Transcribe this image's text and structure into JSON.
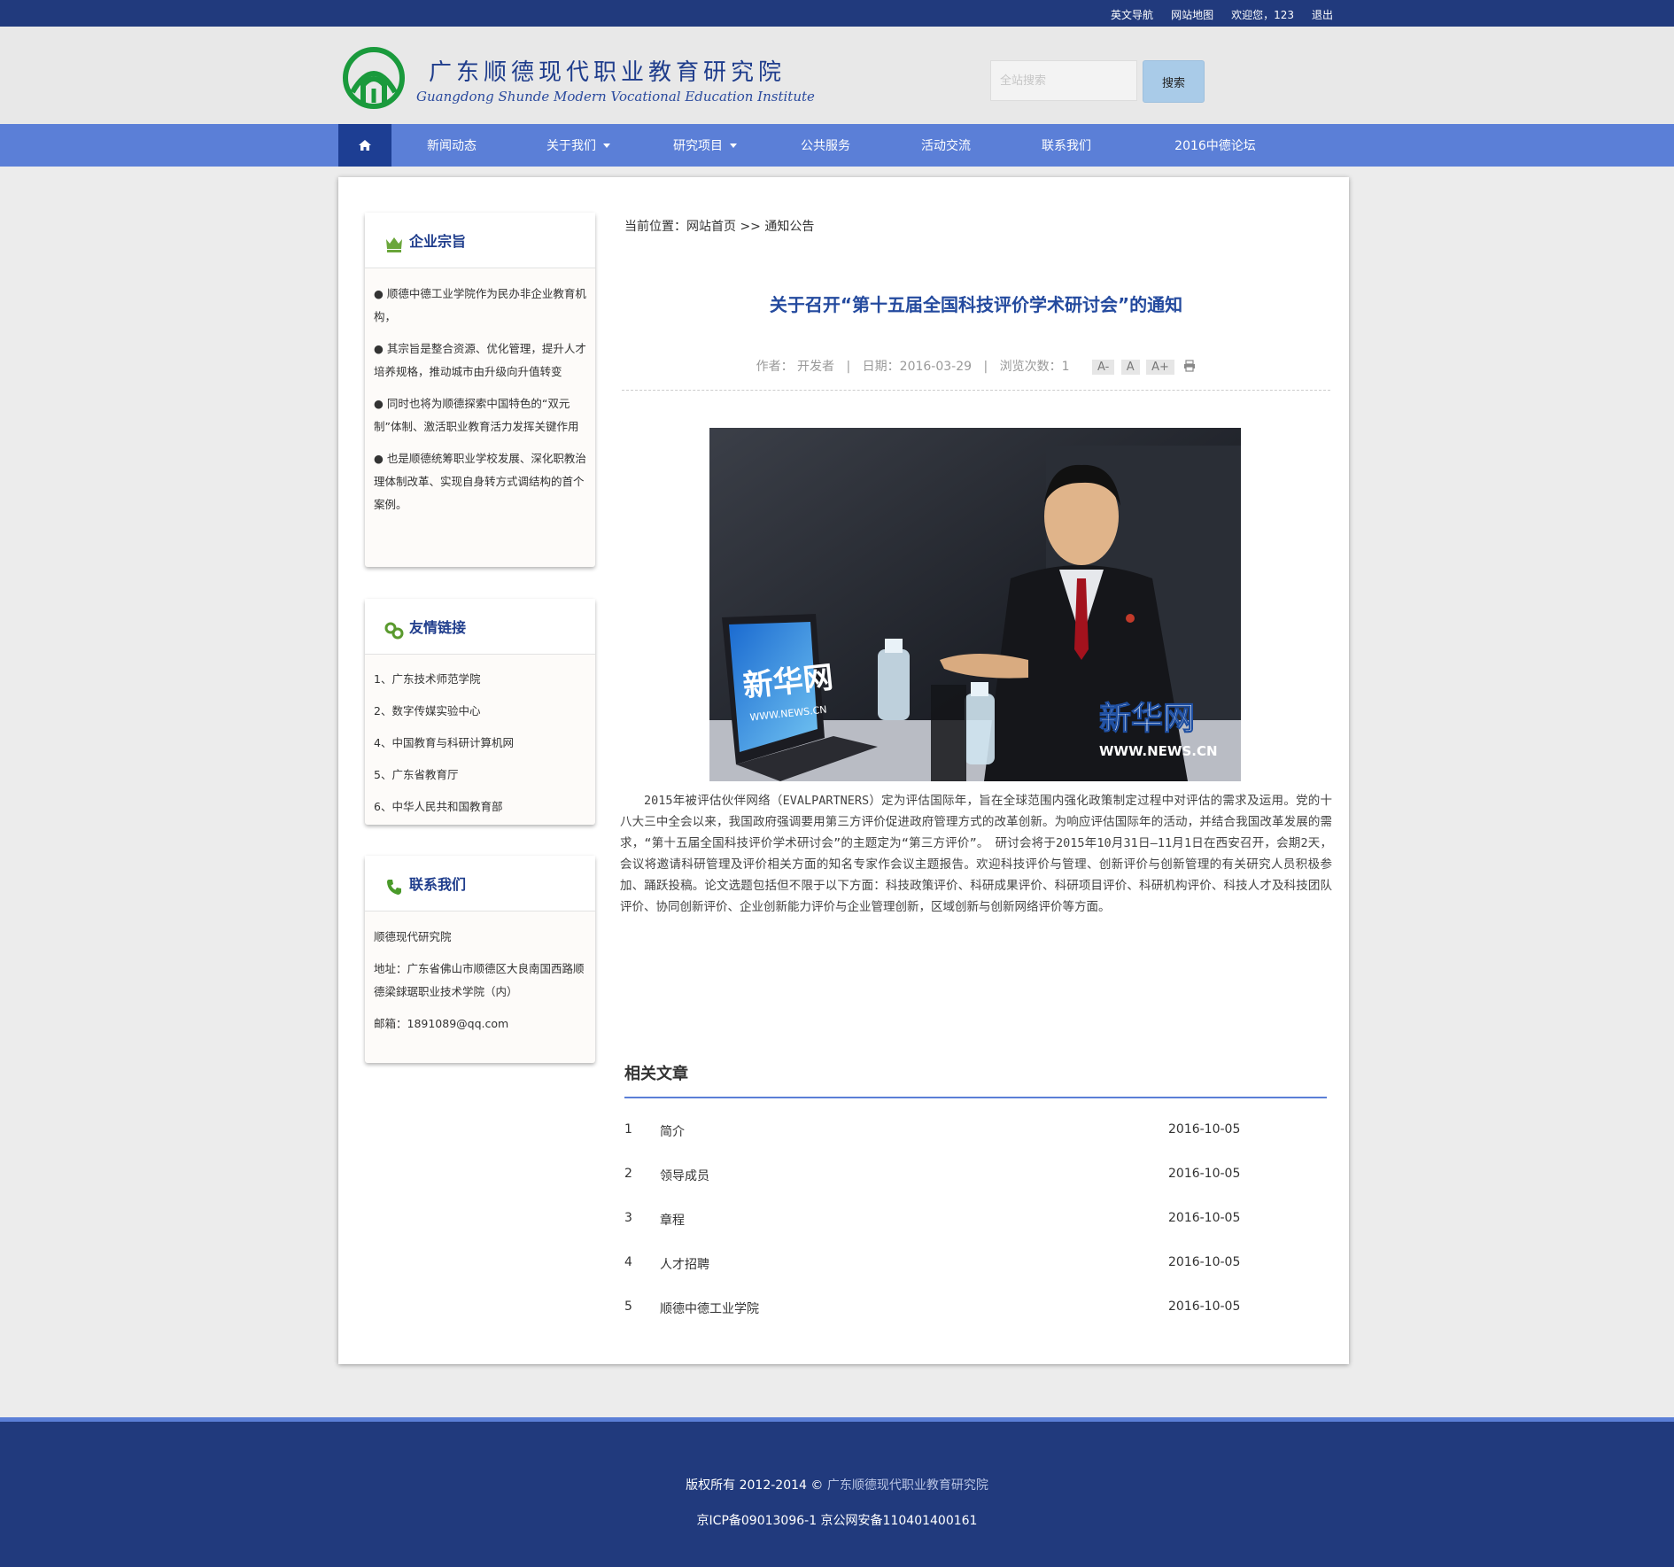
{
  "topbar": {
    "links": [
      "英文导航",
      "网站地图",
      "欢迎您，123",
      "退出"
    ]
  },
  "header": {
    "logo_cn": "广东顺德现代职业教育研究院",
    "logo_en": "Guangdong Shunde Modern Vocational Education Institute",
    "search_placeholder": "全站搜索",
    "search_button": "搜索"
  },
  "nav": {
    "home_icon": "home-icon",
    "items": [
      "新闻动态",
      "关于我们",
      "研究项目",
      "公共服务",
      "活动交流",
      "联系我们",
      "2016中德论坛"
    ]
  },
  "sidebar": {
    "mission": {
      "title": "企业宗旨",
      "icon": "crown-icon",
      "items": [
        "● 顺德中德工业学院作为民办非企业教育机构，",
        "● 其宗旨是整合资源、优化管理，提升人才培养规格，推动城市由升级向升值转变",
        "● 同时也将为顺德探索中国特色的“双元制”体制、激活职业教育活力发挥关键作用",
        "● 也是顺德统筹职业学校发展、深化职教治理体制改革、实现自身转方式调结构的首个案例。"
      ]
    },
    "links": {
      "title": "友情链接",
      "icon": "link-icon",
      "items": [
        "1、广东技术师范学院",
        "2、数字传媒实验中心",
        "4、中国教育与科研计算机网",
        "5、广东省教育厅",
        "6、中华人民共和国教育部"
      ]
    },
    "contact": {
      "title": "联系我们",
      "icon": "phone-icon",
      "items": [
        "顺德现代研究院",
        "地址：广东省佛山市顺德区大良南国西路顺德梁銶琚职业技术学院（内）",
        "邮箱：1891089@qq.com"
      ]
    }
  },
  "article": {
    "breadcrumb_prefix": "当前位置：",
    "breadcrumb_home": "网站首页",
    "breadcrumb_sep": " >> ",
    "breadcrumb_current": "通知公告",
    "title": "关于召开“第十五届全国科技评价学术研讨会”的通知",
    "author_label": "作者：",
    "author": "开发者",
    "date_label": "日期：",
    "date": "2016-03-29",
    "views_label": "浏览次数：",
    "views": "1",
    "font_small": "A-",
    "font_normal": "A",
    "font_large": "A+",
    "print_icon": "print-icon",
    "photo_watermark": "新华网",
    "photo_watermark_url": "WWW.NEWS.CN",
    "laptop_text": "新华网",
    "laptop_url": "WWW.NEWS.CN",
    "body": "2015年被评估伙伴网络（EVALPARTNERS）定为评估国际年，旨在全球范围内强化政策制定过程中对评估的需求及运用。党的十八大三中全会以来，我国政府强调要用第三方评价促进政府管理方式的改革创新。为响应评估国际年的活动，并结合我国改革发展的需求，“第十五届全国科技评价学术研讨会”的主题定为“第三方评价”。　研讨会将于2015年10月31日—11月1日在西安召开，会期2天，会议将邀请科研管理及评价相关方面的知名专家作会议主题报告。欢迎科技评价与管理、创新评价与创新管理的有关研究人员积极参加、踊跃投稿。论文选题包括但不限于以下方面：科技政策评价、科研成果评价、科研项目评价、科研机构评价、科技人才及科技团队评价、协同创新评价、企业创新能力评价与企业管理创新，区域创新与创新网络评价等方面。"
  },
  "related": {
    "title": "相关文章",
    "rows": [
      {
        "num": "1",
        "name": "简介",
        "date": "2016-10-05"
      },
      {
        "num": "2",
        "name": "领导成员",
        "date": "2016-10-05"
      },
      {
        "num": "3",
        "name": "章程",
        "date": "2016-10-05"
      },
      {
        "num": "4",
        "name": "人才招聘",
        "date": "2016-10-05"
      },
      {
        "num": "5",
        "name": "顺德中德工业学院",
        "date": "2016-10-05"
      }
    ]
  },
  "footer": {
    "copyright": "版权所有 2012-2014 © ",
    "org": "广东顺德现代职业教育研究院",
    "icp": "京ICP备09013096-1 京公网安备110401400161"
  },
  "colors": {
    "topbar": "#213a7d",
    "nav": "#5b7fd7",
    "nav_active": "#1d3e93",
    "title": "#244a9e",
    "footer": "#213a7d"
  }
}
